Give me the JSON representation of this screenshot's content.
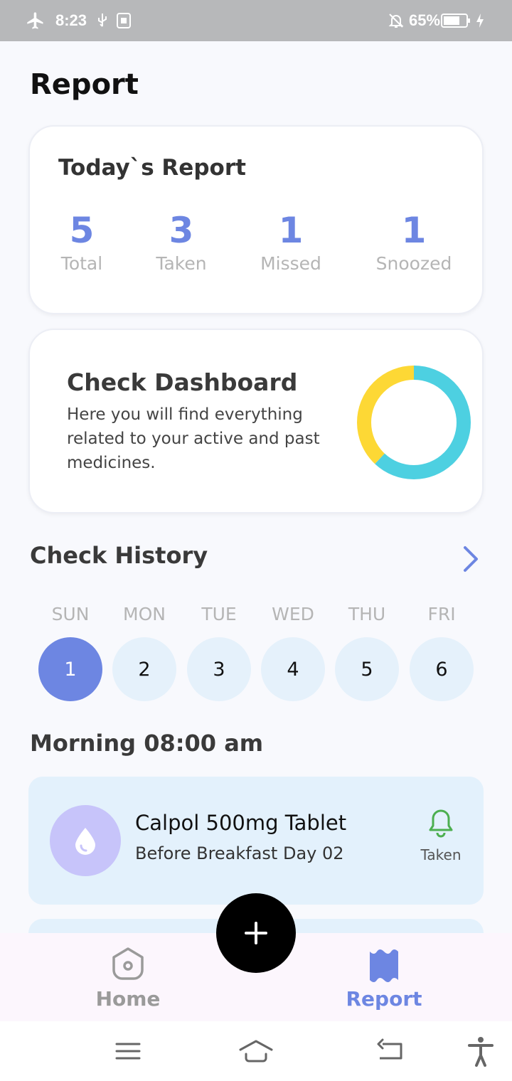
{
  "status_bar": {
    "time": "8:23",
    "battery_percent": "65%",
    "icons": [
      "airplane-icon",
      "usb-icon",
      "photo-icon",
      "bell-off-icon",
      "battery-icon",
      "charging-icon"
    ]
  },
  "page": {
    "title": "Report"
  },
  "todays_report": {
    "title": "Today`s Report",
    "stats": [
      {
        "value": "5",
        "label": "Total"
      },
      {
        "value": "3",
        "label": "Taken"
      },
      {
        "value": "1",
        "label": "Missed"
      },
      {
        "value": "1",
        "label": "Snoozed"
      }
    ]
  },
  "dashboard": {
    "title": "Check Dashboard",
    "description": "Here you will find everything related to your active and past medicines.",
    "donut": {
      "segments": [
        {
          "color": "#4dd0e1",
          "fraction": 0.62
        },
        {
          "color": "#fdd835",
          "fraction": 0.38
        }
      ]
    }
  },
  "history": {
    "title": "Check History",
    "days": [
      {
        "name": "SUN",
        "date": "1",
        "selected": true
      },
      {
        "name": "MON",
        "date": "2",
        "selected": false
      },
      {
        "name": "TUE",
        "date": "3",
        "selected": false
      },
      {
        "name": "WED",
        "date": "4",
        "selected": false
      },
      {
        "name": "THU",
        "date": "5",
        "selected": false
      },
      {
        "name": "FRI",
        "date": "6",
        "selected": false
      }
    ]
  },
  "schedule": {
    "slot_title": "Morning 08:00 am",
    "medicine": {
      "name": "Calpol 500mg Tablet",
      "instruction": "Before Breakfast Day 02",
      "status": "Taken"
    }
  },
  "bottom_nav": {
    "items": [
      {
        "label": "Home",
        "active": false
      },
      {
        "label": "Report",
        "active": true
      }
    ]
  },
  "colors": {
    "accent": "#6d86e2",
    "taken_green": "#4caf50",
    "fab": "#000000"
  }
}
